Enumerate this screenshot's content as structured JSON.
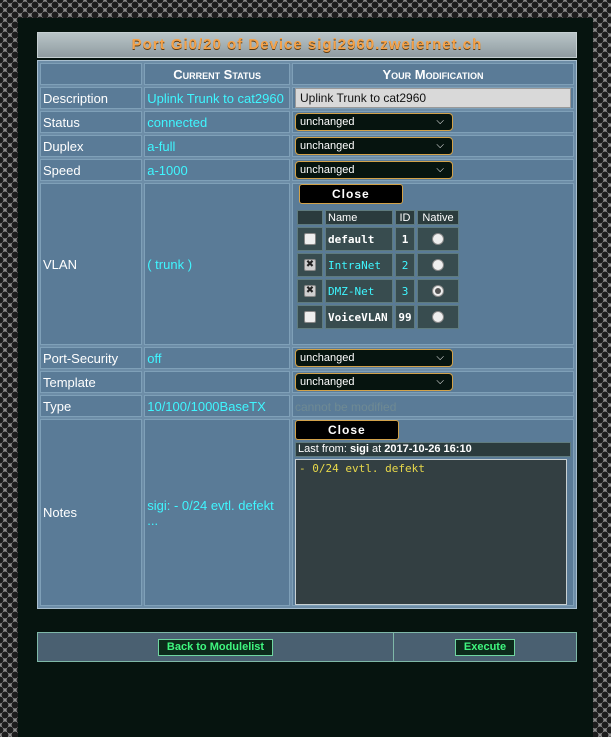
{
  "title": "Port Gi0/20 of Device sigi2960.zweiernet.ch",
  "headers": {
    "current": "Current Status",
    "modification": "Your Modification"
  },
  "rows": {
    "description": {
      "label": "Description",
      "current": "Uplink Trunk to cat2960",
      "input_value": "Uplink Trunk to cat2960"
    },
    "status": {
      "label": "Status",
      "current": "connected",
      "select": "unchanged"
    },
    "duplex": {
      "label": "Duplex",
      "current": "a-full",
      "select": "unchanged"
    },
    "speed": {
      "label": "Speed",
      "current": "a-1000",
      "select": "unchanged"
    },
    "vlan": {
      "label": "VLAN",
      "current": "( trunk )",
      "close_label": "Close"
    },
    "port_security": {
      "label": "Port-Security",
      "current": "off",
      "select": "unchanged"
    },
    "template": {
      "label": "Template",
      "current": "",
      "select": "unchanged"
    },
    "type": {
      "label": "Type",
      "current": "10/100/1000BaseTX",
      "note": "cannot be modified"
    },
    "notes": {
      "label": "Notes",
      "current": "sigi: - 0/24 evtl. defekt ...",
      "close_label": "Close",
      "last_from_prefix": "Last from:",
      "last_from_user": "sigi",
      "last_from_at": "at",
      "last_from_time": "2017-10-26 16:10",
      "text": "- 0/24 evtl. defekt"
    }
  },
  "vlan_table": {
    "headers": {
      "name": "Name",
      "id": "ID",
      "native": "Native"
    },
    "items": [
      {
        "name": "default",
        "id": "1",
        "checked": false,
        "native": false
      },
      {
        "name": "IntraNet",
        "id": "2",
        "checked": true,
        "native": false
      },
      {
        "name": "DMZ-Net",
        "id": "3",
        "checked": true,
        "native": true
      },
      {
        "name": "VoiceVLAN",
        "id": "99",
        "checked": false,
        "native": false
      }
    ]
  },
  "actions": {
    "back_label": "Back to Modulelist",
    "execute_label": "Execute"
  },
  "colors": {
    "accent_title": "#f4a24a",
    "value_text": "#3ff6ff",
    "button_green": "#3ff67f"
  }
}
